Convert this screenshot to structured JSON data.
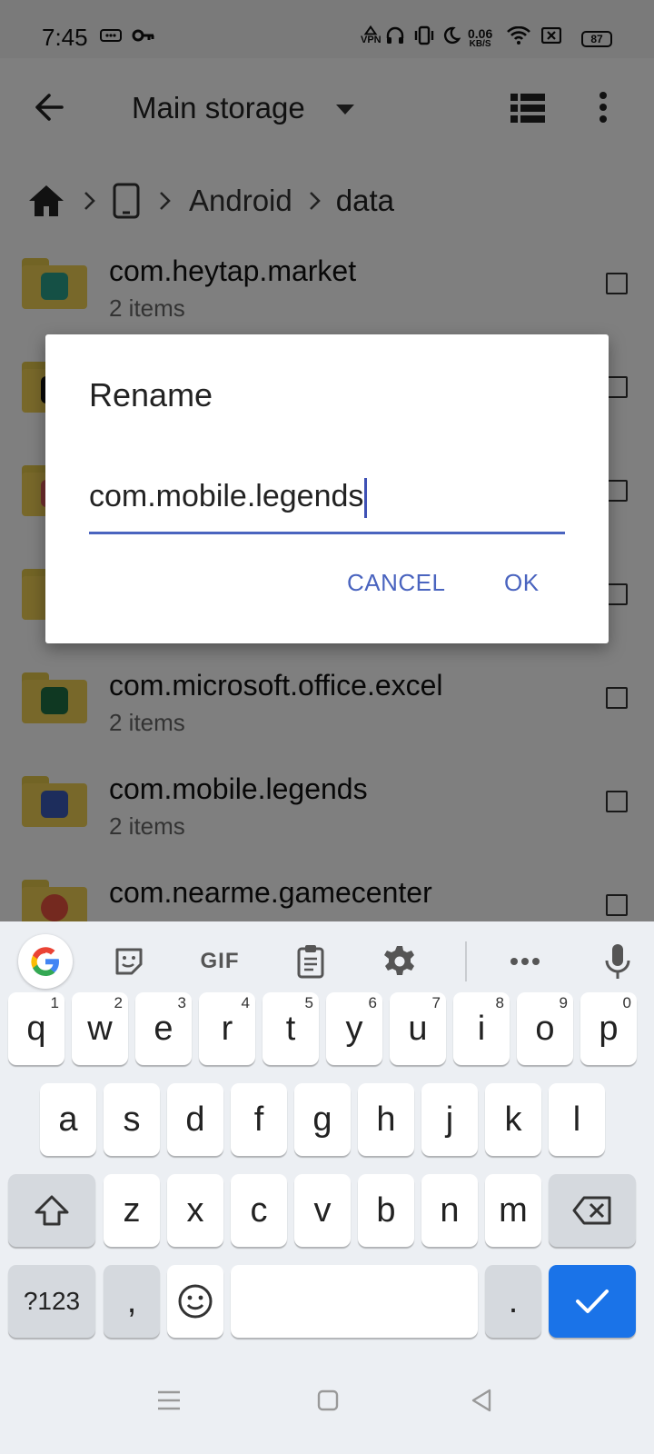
{
  "status_bar": {
    "time": "7:45",
    "vpn_label": "VPN",
    "speed_value": "0.06",
    "speed_unit": "KB/S",
    "battery": "87"
  },
  "app_bar": {
    "title": "Main storage"
  },
  "breadcrumb": {
    "items": [
      "Android",
      "data"
    ]
  },
  "files": [
    {
      "name": "com.heytap.market",
      "sub": "2 items",
      "badge_color": "#2aa08a"
    },
    {
      "name": "",
      "sub": "",
      "badge_color": "#111111"
    },
    {
      "name": "",
      "sub": "",
      "badge_color": "#e05b5b"
    },
    {
      "name": "",
      "sub": "",
      "badge_color": ""
    },
    {
      "name": "com.microsoft.office.excel",
      "sub": "2 items",
      "badge_color": "#1e7145"
    },
    {
      "name": "com.mobile.legends",
      "sub": "2 items",
      "badge_color": "#3b5ab8"
    },
    {
      "name": "com.nearme.gamecenter",
      "sub": "",
      "badge_color": "#e8533f"
    }
  ],
  "dialog": {
    "title": "Rename",
    "value": "com.mobile.legends",
    "cancel": "CANCEL",
    "ok": "OK"
  },
  "keyboard": {
    "toolbar": {
      "gif": "GIF"
    },
    "row1": [
      {
        "k": "q",
        "h": "1"
      },
      {
        "k": "w",
        "h": "2"
      },
      {
        "k": "e",
        "h": "3"
      },
      {
        "k": "r",
        "h": "4"
      },
      {
        "k": "t",
        "h": "5"
      },
      {
        "k": "y",
        "h": "6"
      },
      {
        "k": "u",
        "h": "7"
      },
      {
        "k": "i",
        "h": "8"
      },
      {
        "k": "o",
        "h": "9"
      },
      {
        "k": "p",
        "h": "0"
      }
    ],
    "row2": [
      "a",
      "s",
      "d",
      "f",
      "g",
      "h",
      "j",
      "k",
      "l"
    ],
    "row3": [
      "z",
      "x",
      "c",
      "v",
      "b",
      "n",
      "m"
    ],
    "symbols": "?123",
    "comma": ",",
    "period": "."
  },
  "colors": {
    "accent": "#4a64bf",
    "enter_key": "#1a73e8",
    "folder": "#f1d154"
  }
}
